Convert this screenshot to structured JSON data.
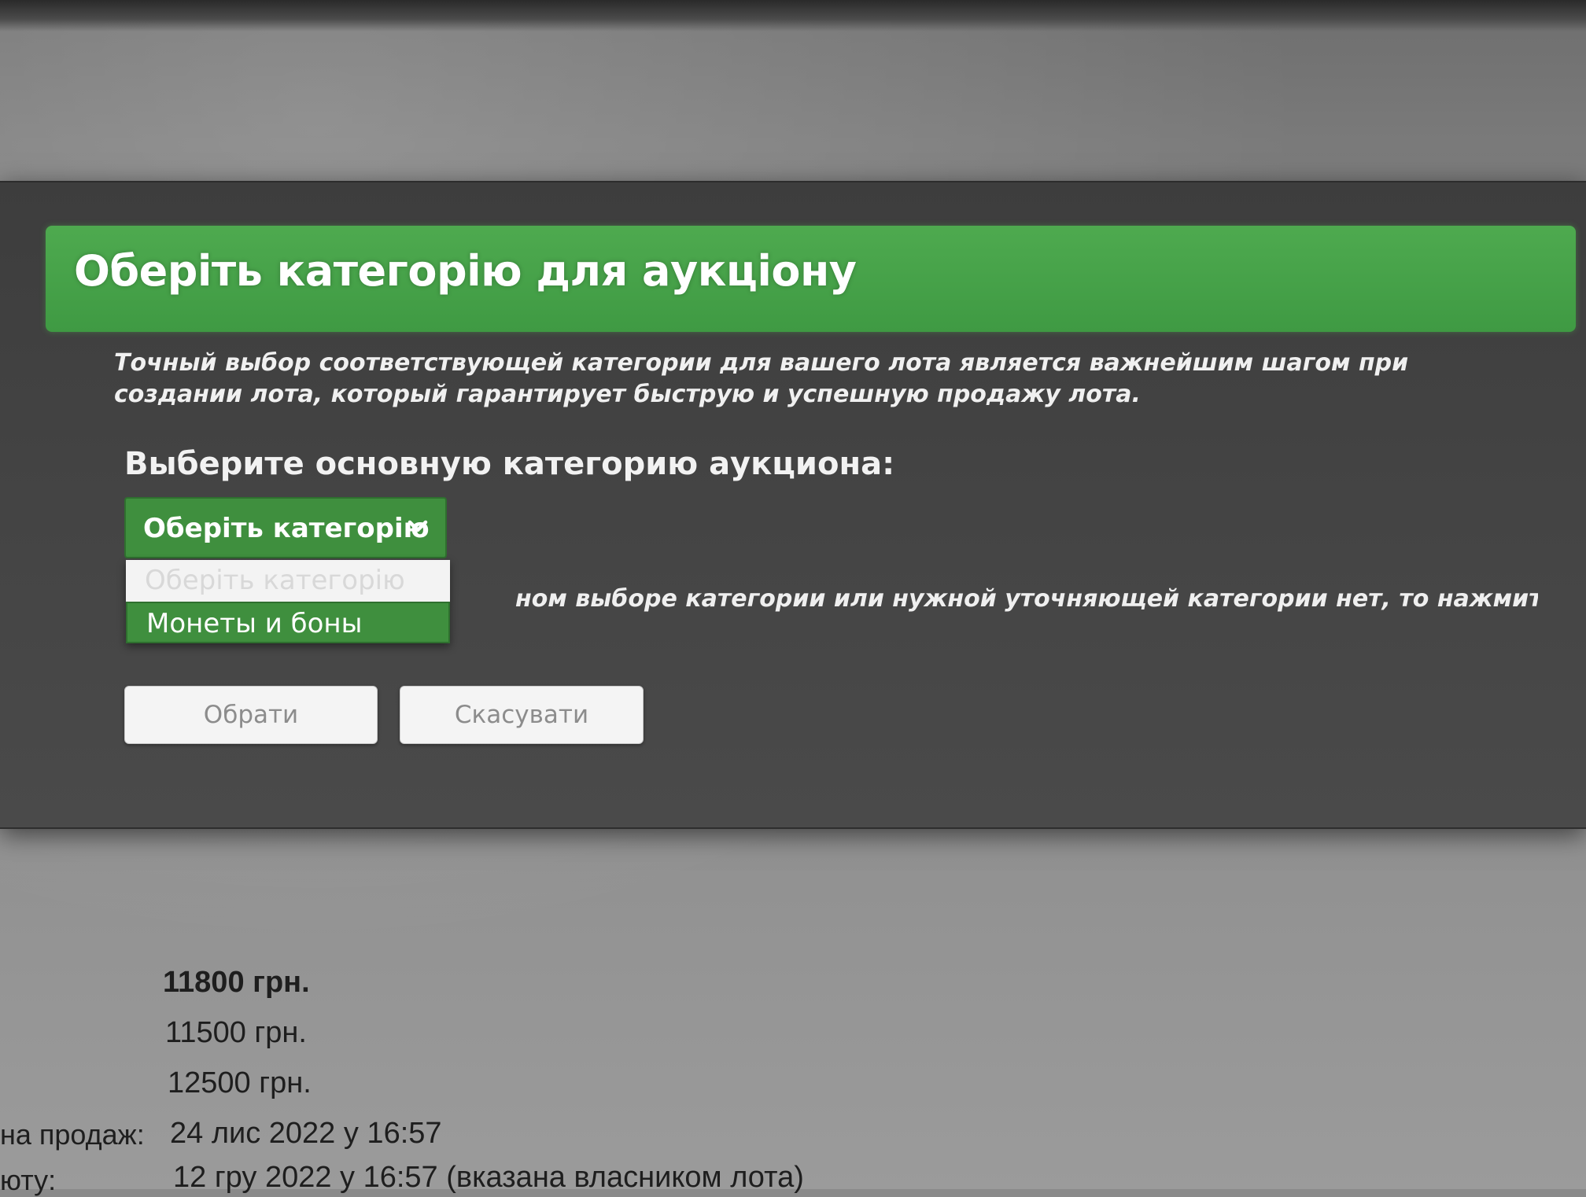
{
  "modal": {
    "title": "Оберіть категорію для аукціону",
    "intro": "Точный выбор соответствующей категории для вашего лота является важнейшим шагом при создании лота, который гарантирует быструю и успешную продажу лота.",
    "select_label": "Выберите основную категорию аукциона:",
    "select_value": "Оберіть категорію",
    "select_icon": "chevron-down-icon",
    "dropdown_options": [
      "Оберіть категорію",
      "Монеты и боны"
    ],
    "hint_partial": "ном выборе категории или нужной уточняющей категории нет, то нажмите",
    "buttons": {
      "ok": "Обрати",
      "cancel": "Скасувати"
    }
  },
  "lot_info": {
    "prices": [
      "11800 грн.",
      "11500 грн.",
      "12500 грн."
    ],
    "sale_label_partial": "на продаж:",
    "sale_date": "24 лис 2022 у 16:57",
    "end_label_partial": "юту:",
    "end_date": "12 гру 2022 у 16:57 (вказана власником лота)"
  },
  "colors": {
    "accent_green": "#3f8f3e",
    "header_green": "#4eaa4f",
    "modal_bg": "#424242"
  }
}
